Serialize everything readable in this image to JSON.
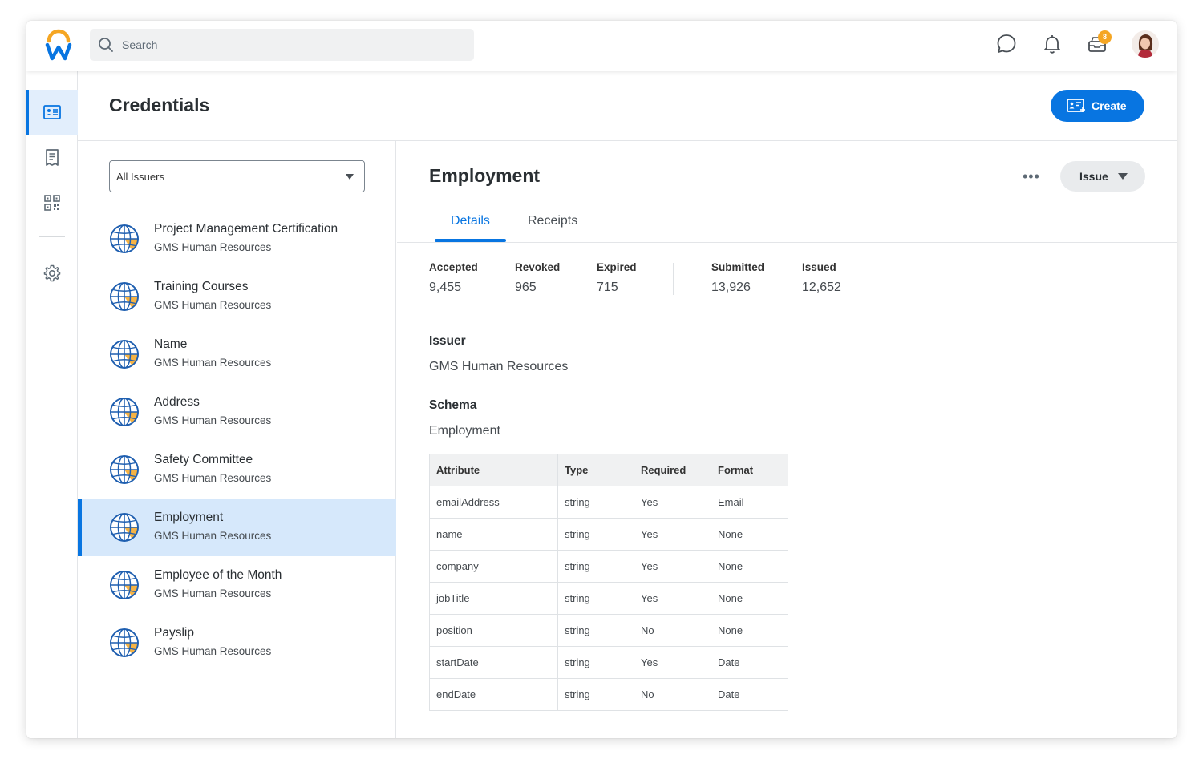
{
  "search": {
    "placeholder": "Search"
  },
  "notifications": {
    "inbox_badge": "8"
  },
  "page": {
    "title": "Credentials",
    "create_label": "Create"
  },
  "filter": {
    "selected": "All Issuers"
  },
  "list": [
    {
      "title": "Project Management Certification",
      "issuer": "GMS Human Resources"
    },
    {
      "title": "Training Courses",
      "issuer": "GMS Human Resources"
    },
    {
      "title": "Name",
      "issuer": "GMS Human Resources"
    },
    {
      "title": "Address",
      "issuer": "GMS Human Resources"
    },
    {
      "title": "Safety Committee",
      "issuer": "GMS Human Resources"
    },
    {
      "title": "Employment",
      "issuer": "GMS Human Resources"
    },
    {
      "title": "Employee of the Month",
      "issuer": "GMS Human Resources"
    },
    {
      "title": "Payslip",
      "issuer": "GMS Human Resources"
    }
  ],
  "detail": {
    "title": "Employment",
    "more": "•••",
    "issue_label": "Issue",
    "tabs": [
      "Details",
      "Receipts"
    ],
    "stats": [
      {
        "label": "Accepted",
        "value": "9,455"
      },
      {
        "label": "Revoked",
        "value": "965"
      },
      {
        "label": "Expired",
        "value": "715"
      },
      {
        "label": "Submitted",
        "value": "13,926"
      },
      {
        "label": "Issued",
        "value": "12,652"
      }
    ],
    "issuer_label": "Issuer",
    "issuer_value": "GMS Human Resources",
    "schema_label": "Schema",
    "schema_value": "Employment",
    "table": {
      "headers": [
        "Attribute",
        "Type",
        "Required",
        "Format"
      ],
      "rows": [
        [
          "emailAddress",
          "string",
          "Yes",
          "Email"
        ],
        [
          "name",
          "string",
          "Yes",
          "None"
        ],
        [
          "company",
          "string",
          "Yes",
          "None"
        ],
        [
          "jobTitle",
          "string",
          "Yes",
          "None"
        ],
        [
          "position",
          "string",
          "No",
          "None"
        ],
        [
          "startDate",
          "string",
          "Yes",
          "Date"
        ],
        [
          "endDate",
          "string",
          "No",
          "Date"
        ]
      ]
    }
  },
  "colors": {
    "accent": "#0875e1",
    "logo_orange": "#f5a623",
    "selected_bg": "#d6e8fb"
  }
}
